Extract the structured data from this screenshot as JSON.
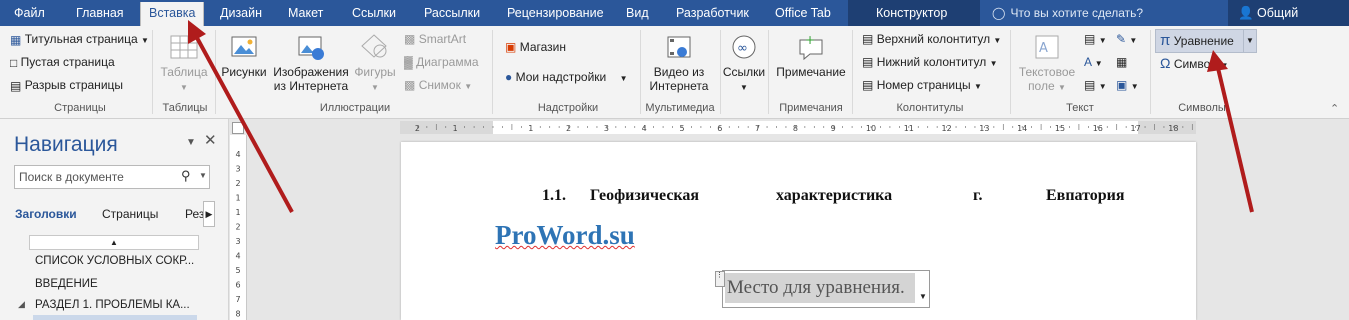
{
  "tabs": [
    "Файл",
    "Главная",
    "Вставка",
    "Дизайн",
    "Макет",
    "Ссылки",
    "Рассылки",
    "Рецензирование",
    "Вид",
    "Разработчик",
    "Office Tab",
    "Конструктор"
  ],
  "tell_me": "Что вы хотите сделать?",
  "share": "Общий доступ",
  "groups": {
    "pages": {
      "label": "Страницы",
      "items": [
        "Титульная страница",
        "Пустая страница",
        "Разрыв страницы"
      ]
    },
    "tables": {
      "label": "Таблицы",
      "table": "Таблица"
    },
    "illustrations": {
      "label": "Иллюстрации",
      "pictures": "Рисунки",
      "online_pictures_1": "Изображения",
      "online_pictures_2": "из Интернета",
      "shapes": "Фигуры",
      "smartart": "SmartArt",
      "chart": "Диаграмма",
      "screenshot": "Снимок"
    },
    "addins": {
      "label": "Надстройки",
      "store": "Магазин",
      "my_addins": "Мои надстройки"
    },
    "media": {
      "label": "Мультимедиа",
      "video_1": "Видео из",
      "video_2": "Интернета"
    },
    "links": {
      "label": "",
      "links": "Ссылки"
    },
    "comments": {
      "label": "Примечания",
      "comment": "Примечание"
    },
    "header_footer": {
      "label": "Колонтитулы",
      "header": "Верхний колонтитул",
      "footer": "Нижний колонтитул",
      "page_number": "Номер страницы"
    },
    "text": {
      "label": "Текст",
      "textbox_1": "Текстовое",
      "textbox_2": "поле"
    },
    "symbols": {
      "label": "Символы",
      "equation": "Уравнение",
      "symbol": "Символ"
    }
  },
  "nav": {
    "title": "Навигация",
    "search_placeholder": "Поиск в документе",
    "tabs": [
      "Заголовки",
      "Страницы",
      "Рез"
    ],
    "items": [
      "СПИСОК УСЛОВНЫХ СОКР...",
      "ВВЕДЕНИЕ",
      "РАЗДЕЛ 1.  ПРОБЛЕМЫ КА..."
    ]
  },
  "ruler_numbers": [
    "2",
    "1",
    "1",
    "2",
    "3",
    "4",
    "5",
    "6",
    "7",
    "8",
    "9",
    "10",
    "11",
    "12",
    "13",
    "14",
    "15",
    "16",
    "17",
    "18"
  ],
  "vruler_numbers": [
    "4",
    "3",
    "2",
    "1",
    "1",
    "2",
    "3",
    "4",
    "5",
    "6",
    "7",
    "8"
  ],
  "document": {
    "heading": [
      "1.1.",
      "Геофизическая",
      "характеристика",
      "г.",
      "Евпатория"
    ],
    "watermark": "ProWord.su",
    "equation_placeholder": "Место для уравнения."
  },
  "colors": {
    "accent": "#2b579a",
    "arrow": "#b01c1c",
    "equation_highlight": "#cfd6e4"
  }
}
